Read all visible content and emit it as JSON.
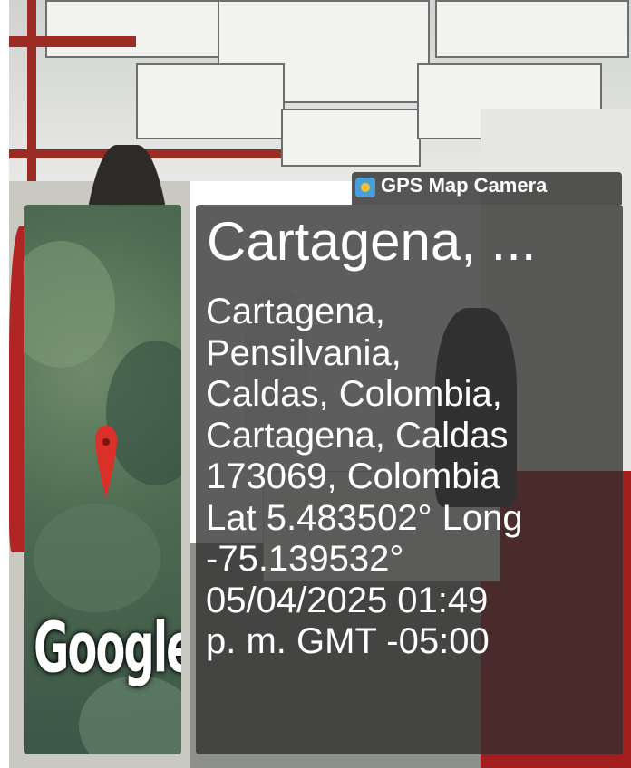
{
  "badge": {
    "icon": "gps-map-camera-icon",
    "label": "GPS Map Camera"
  },
  "map": {
    "logo": "Google",
    "pin_color": "#d9302a"
  },
  "location": {
    "title": "Cartagena, ...",
    "address_lines": [
      "Cartagena,",
      "Pensilvania,",
      "Caldas, Colombia,",
      "Cartagena, Caldas",
      "173069, Colombia"
    ],
    "coords_line": "Lat 5.483502° Long",
    "coords_cont": "-75.139532°",
    "datetime_line": "05/04/2025 01:49",
    "datetime_cont": "p. m. GMT -05:00"
  }
}
